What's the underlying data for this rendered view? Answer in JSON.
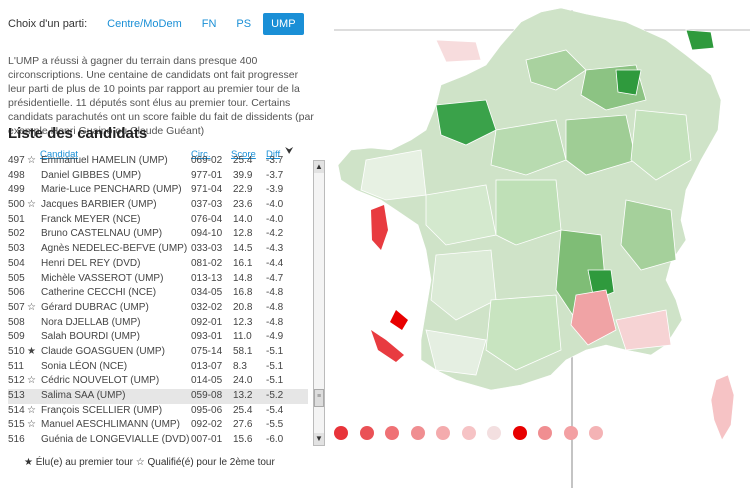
{
  "party_selector": {
    "label": "Choix d'un parti:",
    "options": [
      {
        "label": "Centre/MoDem",
        "active": false
      },
      {
        "label": "FN",
        "active": false
      },
      {
        "label": "PS",
        "active": false
      },
      {
        "label": "UMP",
        "active": true
      }
    ]
  },
  "intro": "L'UMP a réussi à gagner du terrain dans presque 400 circonscriptions. Une centaine de candidats ont fait progresser leur parti de plus de 10 points par rapport au premier tour de la présidentielle. 11 députés sont élus au premier tour. Certains candidats parachutés ont un score faible du fait de dissidents (par exemple Henri Guaino ou Claude Guéant)",
  "list": {
    "title": "Liste des candidats",
    "headers": {
      "candidate": "Candidat",
      "circ": "Circ.",
      "score": "Score",
      "diff": "Diff"
    },
    "rows": [
      {
        "rank": "497",
        "star": "☆",
        "name": "Emmanuel HAMELIN (UMP)",
        "circ": "069-02",
        "score": "25.4",
        "diff": "-3.7"
      },
      {
        "rank": "498",
        "star": "",
        "name": "Daniel GIBBES (UMP)",
        "circ": "977-01",
        "score": "39.9",
        "diff": "-3.7"
      },
      {
        "rank": "499",
        "star": "",
        "name": "Marie-Luce PENCHARD (UMP)",
        "circ": "971-04",
        "score": "22.9",
        "diff": "-3.9"
      },
      {
        "rank": "500",
        "star": "☆",
        "name": "Jacques BARBIER (UMP)",
        "circ": "037-03",
        "score": "23.6",
        "diff": "-4.0"
      },
      {
        "rank": "501",
        "star": "",
        "name": "Franck MEYER (NCE)",
        "circ": "076-04",
        "score": "14.0",
        "diff": "-4.0"
      },
      {
        "rank": "502",
        "star": "",
        "name": "Bruno CASTELNAU (UMP)",
        "circ": "094-10",
        "score": "12.8",
        "diff": "-4.2"
      },
      {
        "rank": "503",
        "star": "",
        "name": "Agnès NEDELEC-BEFVE (UMP)",
        "circ": "033-03",
        "score": "14.5",
        "diff": "-4.3"
      },
      {
        "rank": "504",
        "star": "",
        "name": "Henri DEL REY (DVD)",
        "circ": "081-02",
        "score": "16.1",
        "diff": "-4.4"
      },
      {
        "rank": "505",
        "star": "",
        "name": "Michèle VASSEROT (UMP)",
        "circ": "013-13",
        "score": "14.8",
        "diff": "-4.7"
      },
      {
        "rank": "506",
        "star": "",
        "name": "Catherine CECCHI (NCE)",
        "circ": "034-05",
        "score": "16.8",
        "diff": "-4.8"
      },
      {
        "rank": "507",
        "star": "☆",
        "name": "Gérard DUBRAC (UMP)",
        "circ": "032-02",
        "score": "20.8",
        "diff": "-4.8"
      },
      {
        "rank": "508",
        "star": "",
        "name": "Nora DJELLAB (UMP)",
        "circ": "092-01",
        "score": "12.3",
        "diff": "-4.8"
      },
      {
        "rank": "509",
        "star": "",
        "name": "Salah BOURDI (UMP)",
        "circ": "093-01",
        "score": "11.0",
        "diff": "-4.9"
      },
      {
        "rank": "510",
        "star": "★",
        "name": "Claude GOASGUEN (UMP)",
        "circ": "075-14",
        "score": "58.1",
        "diff": "-5.1"
      },
      {
        "rank": "511",
        "star": "",
        "name": "Sonia LÉON (NCE)",
        "circ": "013-07",
        "score": "8.3",
        "diff": "-5.1"
      },
      {
        "rank": "512",
        "star": "☆",
        "name": "Cédric NOUVELOT (UMP)",
        "circ": "014-05",
        "score": "24.0",
        "diff": "-5.1"
      },
      {
        "rank": "513",
        "star": "",
        "name": "Salima SAA (UMP)",
        "circ": "059-08",
        "score": "13.2",
        "diff": "-5.2",
        "highlight": true
      },
      {
        "rank": "514",
        "star": "☆",
        "name": "François SCELLIER (UMP)",
        "circ": "095-06",
        "score": "25.4",
        "diff": "-5.4"
      },
      {
        "rank": "515",
        "star": "☆",
        "name": "Manuel AESCHLIMANN (UMP)",
        "circ": "092-02",
        "score": "27.6",
        "diff": "-5.5"
      },
      {
        "rank": "516",
        "star": "",
        "name": "Guénia de LONGEVIALLE (DVD)",
        "circ": "007-01",
        "score": "15.6",
        "diff": "-6.0"
      }
    ]
  },
  "legend": "★ Élu(e) au premier tour ☆ Qualifié(é) pour le 2ème tour",
  "map": {
    "swatch_colors": [
      "#e8343a",
      "#ea5156",
      "#ef7175",
      "#f08e91",
      "#f4abad",
      "#f6c3c5",
      "#f3dfe0",
      "#e80000",
      "#f08e91",
      "#f3a0a3",
      "#f4b3b5"
    ]
  }
}
